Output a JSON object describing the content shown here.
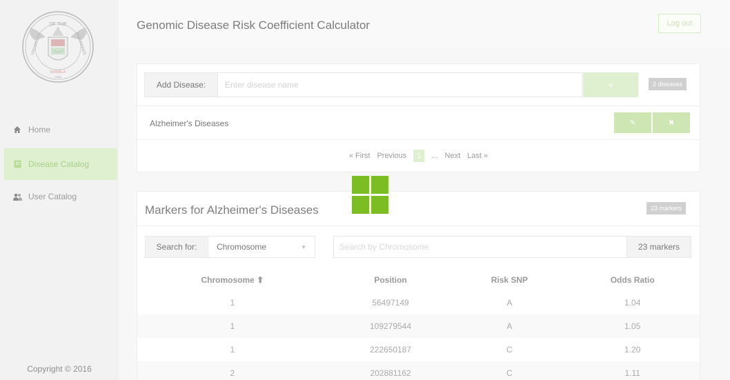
{
  "app": {
    "title": "Genomic Disease Risk Coefficient Calculator",
    "logout_label": "Log out"
  },
  "logo": {
    "ring_top": "OF THE",
    "ring_left": "UNIVERSITY",
    "ring_right": "PHILIPPINES",
    "ring_bottom": "MANILA",
    "year": "1908"
  },
  "sidebar": {
    "items": [
      {
        "label": "Home",
        "icon": "home-icon"
      },
      {
        "label": "Disease Catalog",
        "icon": "book-icon"
      },
      {
        "label": "User Catalog",
        "icon": "users-icon"
      }
    ],
    "copyright": "Copyright © 2016"
  },
  "disease_panel": {
    "add_label": "Add Disease:",
    "add_placeholder": "Enter disease name",
    "add_button": "+",
    "count_badge": "2 diseases",
    "disease_name": "Alzheimer's Diseases",
    "edit_icon": "✎",
    "delete_icon": "✖"
  },
  "pagination": {
    "first": "« First",
    "previous": "Previous",
    "current": "1",
    "ellipsis": "...",
    "next": "Next",
    "last": "Last »"
  },
  "markers_panel": {
    "title": "Markers for Alzheimer's Diseases",
    "count_badge": "23 markers",
    "search_label": "Search for:",
    "search_field": "Chromosome",
    "search_placeholder": "Search by Chromosome",
    "search_count": "23 markers",
    "columns": [
      "Chromosome ⬆",
      "Position",
      "Risk SNP",
      "Odds Ratio"
    ],
    "rows": [
      [
        "1",
        "56497149",
        "A",
        "1.04"
      ],
      [
        "1",
        "109279544",
        "A",
        "1.05"
      ],
      [
        "1",
        "222650187",
        "C",
        "1.20"
      ],
      [
        "2",
        "202881162",
        "C",
        "1.11"
      ]
    ]
  },
  "colors": {
    "accent": "#dff0d0",
    "accent_text": "#a9cf88",
    "windows_logo": "#7cbd24",
    "seal": "#d9a0a0"
  }
}
